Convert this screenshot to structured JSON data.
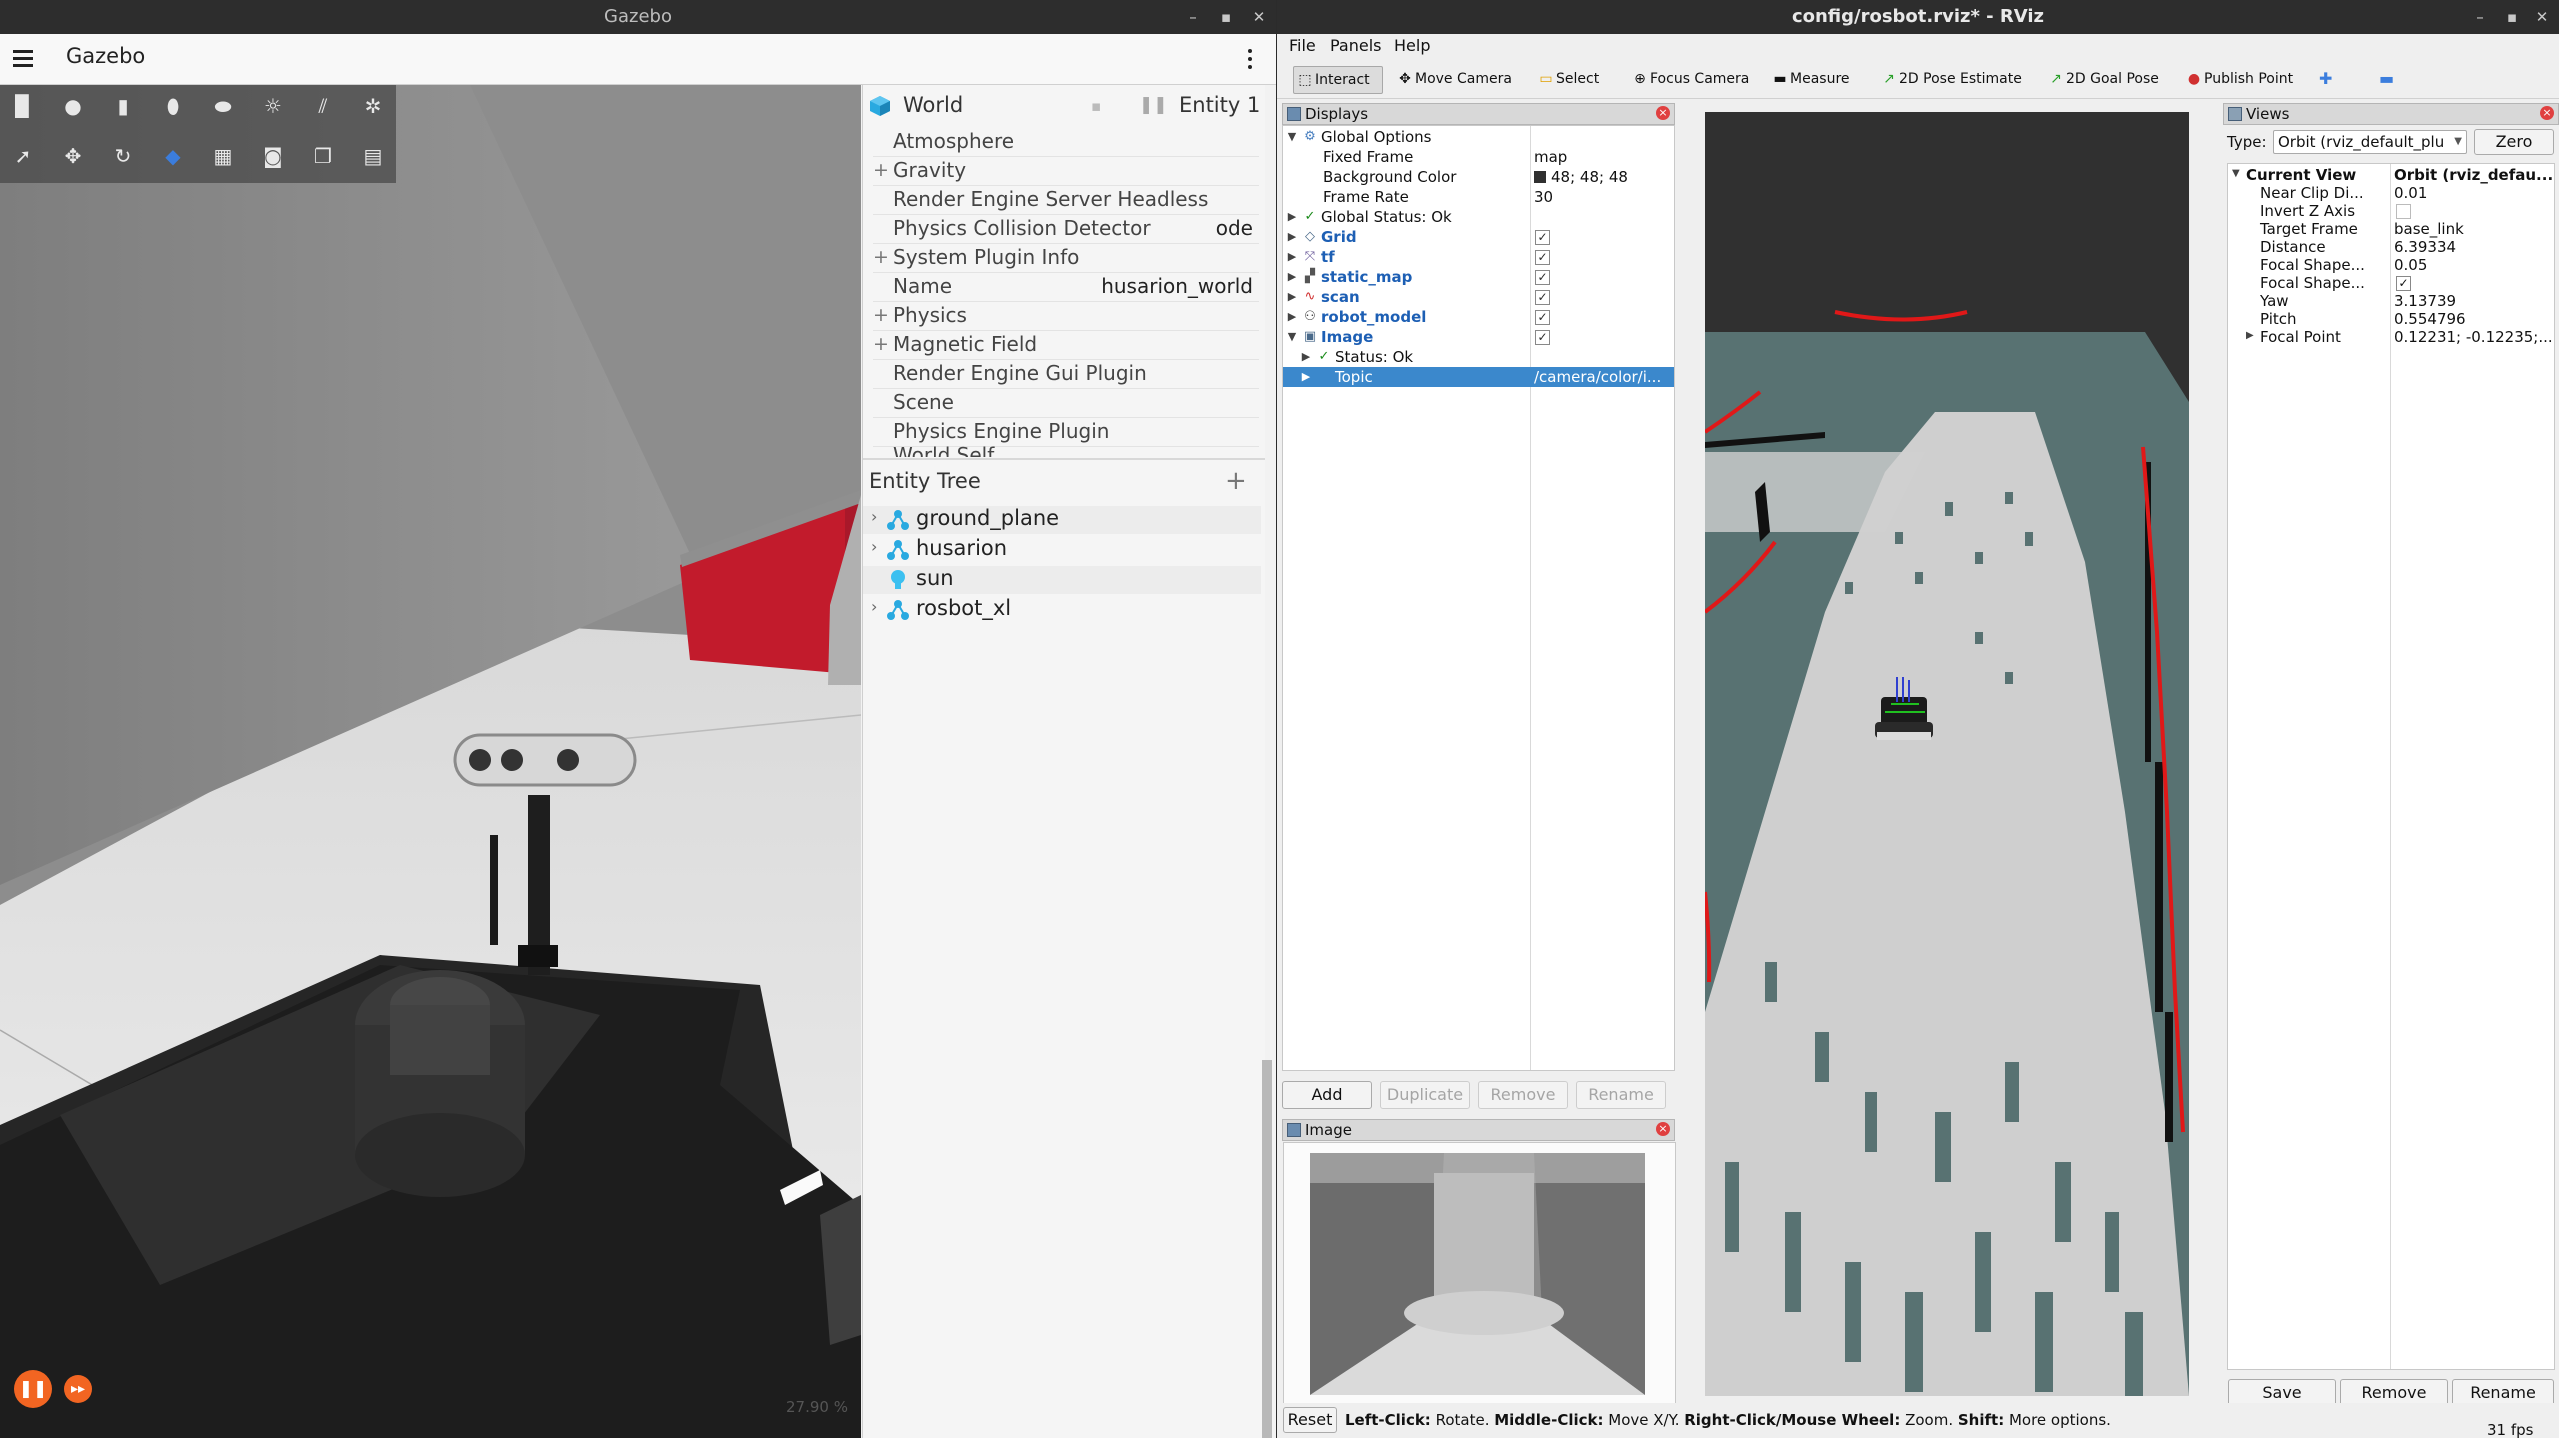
{
  "gazebo": {
    "window_title": "Gazebo",
    "window_controls": {
      "minimize": "–",
      "maximize": "▪",
      "close": "✕"
    },
    "app_title": "Gazebo",
    "toolbar_icons": [
      "box-icon",
      "sphere-icon",
      "cylinder-icon",
      "capsule-icon",
      "ellipsoid-icon",
      "point-light-icon",
      "directional-light-icon",
      "spot-light-icon",
      "select-icon",
      "translate-icon",
      "rotate-icon",
      "snap-icon",
      "grid-icon",
      "screenshot-icon",
      "copy-icon",
      "paste-icon"
    ],
    "zoom_text": "27.90 %",
    "world_panel": {
      "title": "World",
      "entity_label": "Entity 1",
      "properties": [
        {
          "label": "Atmosphere",
          "expandable": false,
          "value": ""
        },
        {
          "label": "Gravity",
          "expandable": true,
          "value": ""
        },
        {
          "label": "Render Engine Server Headless",
          "expandable": false,
          "value": ""
        },
        {
          "label": "Physics Collision Detector",
          "expandable": false,
          "value": "ode"
        },
        {
          "label": "System Plugin Info",
          "expandable": true,
          "value": ""
        },
        {
          "label": "Name",
          "expandable": false,
          "value": "husarion_world"
        },
        {
          "label": "Physics",
          "expandable": true,
          "value": ""
        },
        {
          "label": "Magnetic Field",
          "expandable": true,
          "value": ""
        },
        {
          "label": "Render Engine Gui Plugin",
          "expandable": false,
          "value": ""
        },
        {
          "label": "Scene",
          "expandable": false,
          "value": ""
        },
        {
          "label": "Physics Engine Plugin",
          "expandable": false,
          "value": ""
        },
        {
          "label": "World Self",
          "expandable": false,
          "value": ""
        }
      ]
    },
    "entity_tree": {
      "title": "Entity Tree",
      "items": [
        {
          "name": "ground_plane",
          "icon": "model-icon"
        },
        {
          "name": "husarion",
          "icon": "model-icon"
        },
        {
          "name": "sun",
          "icon": "light-bulb-icon"
        },
        {
          "name": "rosbot_xl",
          "icon": "model-icon"
        }
      ]
    }
  },
  "rviz": {
    "window_title": "config/rosbot.rviz* - RViz",
    "window_controls": {
      "minimize": "–",
      "maximize": "▪",
      "close": "✕"
    },
    "menu": [
      "File",
      "Panels",
      "Help"
    ],
    "tools": [
      {
        "label": "Interact",
        "icon": "⬚",
        "active": true
      },
      {
        "label": "Move Camera",
        "icon": "✥",
        "active": false
      },
      {
        "label": "Select",
        "icon": "▭",
        "active": false
      },
      {
        "label": "Focus Camera",
        "icon": "⊕",
        "active": false
      },
      {
        "label": "Measure",
        "icon": "▬",
        "active": false
      },
      {
        "label": "2D Pose Estimate",
        "icon": "↗",
        "active": false
      },
      {
        "label": "2D Goal Pose",
        "icon": "↗",
        "active": false
      },
      {
        "label": "Publish Point",
        "icon": "📍",
        "active": false
      }
    ],
    "displays": {
      "title": "Displays",
      "global_options": {
        "label": "Global Options",
        "fixed_frame_label": "Fixed Frame",
        "fixed_frame": "map",
        "background_label": "Background Color",
        "background": "48; 48; 48",
        "frame_rate_label": "Frame Rate",
        "frame_rate": "30"
      },
      "global_status": "Global Status: Ok",
      "items": [
        "Grid",
        "tf",
        "static_map",
        "scan",
        "robot_model",
        "Image"
      ],
      "image_status": "Status: Ok",
      "topic_label": "Topic",
      "topic_value": "/camera/color/i...",
      "buttons": {
        "add": "Add",
        "duplicate": "Duplicate",
        "remove": "Remove",
        "rename": "Rename"
      }
    },
    "image_pane": {
      "title": "Image"
    },
    "views": {
      "title": "Views",
      "type_label": "Type:",
      "type_value": "Orbit (rviz_default_plu",
      "zero_button": "Zero",
      "current_view_label": "Current View",
      "current_view_value": "Orbit (rviz_defau...",
      "props": [
        {
          "name": "Near Clip Di...",
          "value": "0.01"
        },
        {
          "name": "Invert Z Axis",
          "value": ""
        },
        {
          "name": "Target Frame",
          "value": "base_link"
        },
        {
          "name": "Distance",
          "value": "6.39334"
        },
        {
          "name": "Focal Shape...",
          "value": "0.05"
        },
        {
          "name": "Focal Shape...",
          "value": ""
        },
        {
          "name": "Yaw",
          "value": "3.13739"
        },
        {
          "name": "Pitch",
          "value": "0.554796"
        },
        {
          "name": "Focal Point",
          "value": "0.12231; -0.12235;..."
        }
      ],
      "buttons": {
        "save": "Save",
        "remove": "Remove",
        "rename": "Rename"
      }
    },
    "status_bar": {
      "reset": "Reset",
      "left_click_b": "Left-Click:",
      "left_click_t": " Rotate. ",
      "middle_click_b": "Middle-Click:",
      "middle_click_t": " Move X/Y. ",
      "right_click_b": "Right-Click/Mouse Wheel:",
      "right_click_t": " Zoom. ",
      "shift_b": "Shift:",
      "shift_t": " More options.",
      "fps": "31 fps"
    }
  }
}
